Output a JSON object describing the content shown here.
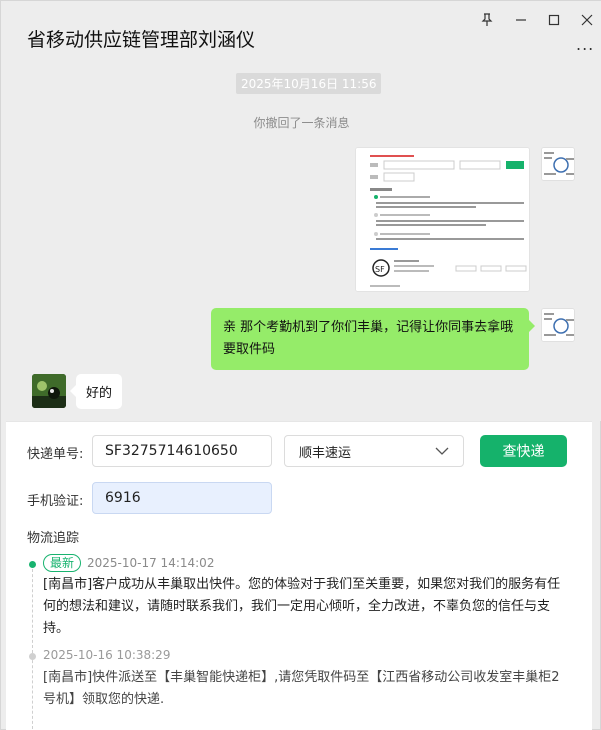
{
  "window": {
    "title": "省移动供应链管理部刘涵仪",
    "pin_icon": "pin-icon",
    "minimize_icon": "minimize-icon",
    "maximize_icon": "maximize-icon",
    "close_icon": "close-icon",
    "more_label": "..."
  },
  "chat": {
    "timestamp": "2025年10月16日 11:56",
    "recall_notice": "你撤回了一条消息",
    "my_message": "亲 那个考勤机到了你们丰巢，记得让你同事去拿哦  要取件码",
    "other_message": "好的"
  },
  "query": {
    "tracking_label": "快递单号:",
    "tracking_value": "SF3275714610650",
    "carrier_value": "顺丰速运",
    "search_button": "查快递",
    "phone_label": "手机验证:",
    "phone_value": "6916"
  },
  "tracking": {
    "section_title": "物流追踪",
    "events": [
      {
        "badge": "最新",
        "time": "2025-10-17 14:14:02",
        "text": "[南昌市]客户成功从丰巢取出快件。您的体验对于我们至关重要，如果您对我们的服务有任何的想法和建议，请随时联系我们，我们一定用心倾听，全力改进，不辜负您的信任与支持。"
      },
      {
        "badge": "",
        "time": "2025-10-16 10:38:29",
        "text": "[南昌市]快件派送至【丰巢智能快递柜】,请您凭取件码至【江西省移动公司收发室丰巢柜2号机】领取您的快递."
      }
    ]
  },
  "colors": {
    "accent": "#15b26b",
    "bubble_me": "#95ec69",
    "background": "#ededed"
  }
}
